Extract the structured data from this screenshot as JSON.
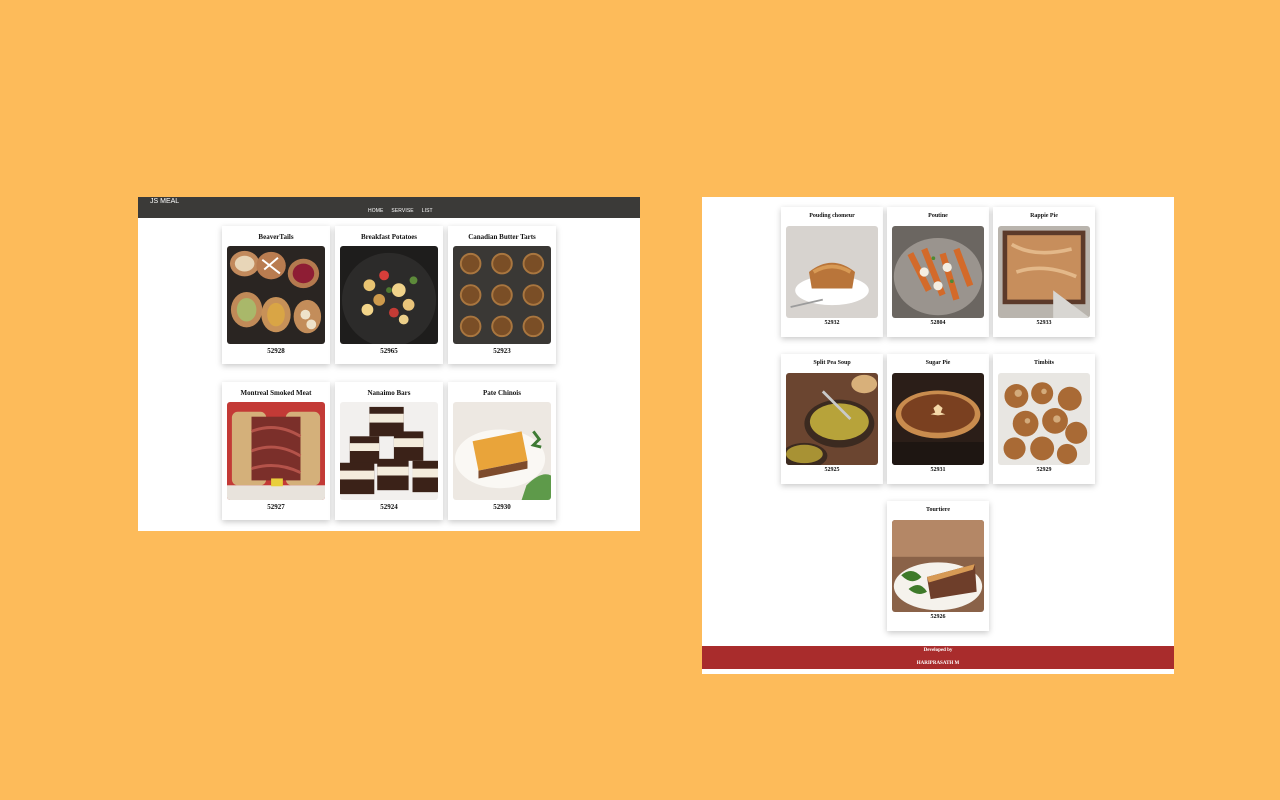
{
  "left_page": {
    "brand": "JS MEAL",
    "nav": [
      "HOME",
      "SERVISE",
      "LIST"
    ],
    "cards": [
      {
        "title": "BeaverTails",
        "id": "52928",
        "image": "beavertails-photo"
      },
      {
        "title": "Breakfast Potatoes",
        "id": "52965",
        "image": "breakfast-potatoes-photo"
      },
      {
        "title": "Canadian Butter Tarts",
        "id": "52923",
        "image": "butter-tarts-photo"
      },
      {
        "title": "Montreal Smoked Meat",
        "id": "52927",
        "image": "smoked-meat-photo"
      },
      {
        "title": "Nanaimo Bars",
        "id": "52924",
        "image": "nanaimo-bars-photo"
      },
      {
        "title": "Pate Chinois",
        "id": "52930",
        "image": "pate-chinois-photo"
      }
    ]
  },
  "right_page": {
    "cards": [
      {
        "title": "Pouding chomeur",
        "id": "52932",
        "image": "pouding-chomeur-photo"
      },
      {
        "title": "Poutine",
        "id": "52804",
        "image": "poutine-photo"
      },
      {
        "title": "Rappie Pie",
        "id": "52933",
        "image": "rappie-pie-photo"
      },
      {
        "title": "Split Pea Soup",
        "id": "52925",
        "image": "split-pea-soup-photo"
      },
      {
        "title": "Sugar Pie",
        "id": "52931",
        "image": "sugar-pie-photo"
      },
      {
        "title": "Timbits",
        "id": "52929",
        "image": "timbits-photo"
      },
      {
        "title": "Tourtiere",
        "id": "52926",
        "image": "tourtiere-photo"
      }
    ],
    "footer": {
      "line1": "Developed by",
      "line2": "HARIPRASATH M"
    }
  },
  "colors": {
    "background": "#FDBB5A",
    "navbar": "#3b3a38",
    "footer": "#A92C2C"
  }
}
